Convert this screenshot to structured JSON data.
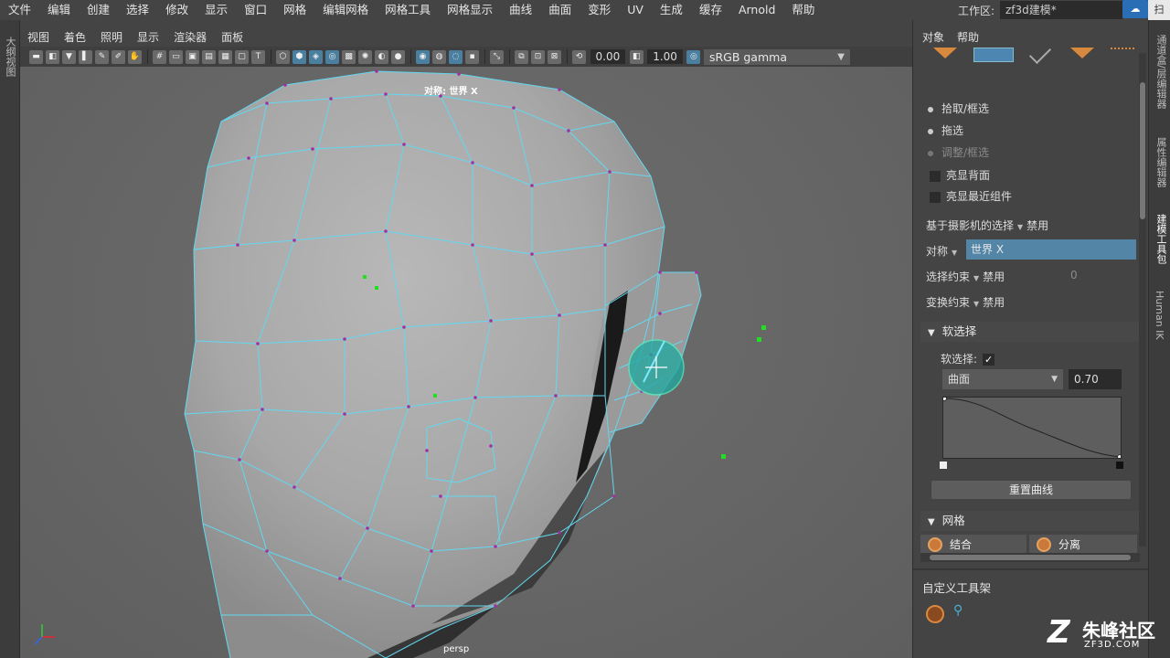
{
  "menubar": {
    "items": [
      "文件",
      "编辑",
      "创建",
      "选择",
      "修改",
      "显示",
      "窗口",
      "网格",
      "编辑网格",
      "网格工具",
      "网格显示",
      "曲线",
      "曲面",
      "变形",
      "UV",
      "生成",
      "缓存",
      "Arnold",
      "帮助"
    ],
    "workspace_label": "工作区:",
    "workspace_value": "zf3d建模*"
  },
  "left_strip": {
    "label": "大纲视图"
  },
  "viewport": {
    "menus": [
      "视图",
      "着色",
      "照明",
      "显示",
      "渲染器",
      "面板"
    ],
    "exposure": "0.00",
    "gamma": "1.00",
    "color_space": "sRGB gamma",
    "symmetry_label": "对称: 世界 X",
    "camera_label": "persp"
  },
  "right_panel": {
    "menus": [
      "对象",
      "帮助"
    ],
    "select_options": [
      {
        "label": "拾取/框选",
        "state": "on"
      },
      {
        "label": "拖选",
        "state": "on"
      },
      {
        "label": "调整/框选",
        "state": "dim"
      }
    ],
    "checkboxes": [
      {
        "label": "亮显背面"
      },
      {
        "label": "亮显最近组件"
      }
    ],
    "camera_select_label": "基于摄影机的选择",
    "camera_select_value": "禁用",
    "symmetry_label": "对称",
    "symmetry_value": "世界 X",
    "select_constraint_label": "选择约束",
    "select_constraint_value": "禁用",
    "select_constraint_num": "0",
    "transform_constraint_label": "变换约束",
    "transform_constraint_value": "禁用",
    "soft_select_section": "软选择",
    "soft_select_label": "软选择:",
    "falloff_mode": "曲面",
    "falloff_radius": "0.70",
    "reset_curve": "重置曲线",
    "mesh_section": "网格",
    "combine_label": "结合",
    "separate_label": "分离",
    "custom_shelf": "自定义工具架"
  },
  "right_tabs": [
    "通道盒/层编辑器",
    "属性编辑器",
    "建模工具包",
    "Human IK"
  ],
  "watermark": {
    "title": "朱峰社区",
    "subtitle": "ZF3D.COM"
  },
  "colors": {
    "wire": "#62d8f0",
    "vertex": "#a030a0",
    "brush": "#20c0b0",
    "accent_blue": "#5285a6"
  }
}
